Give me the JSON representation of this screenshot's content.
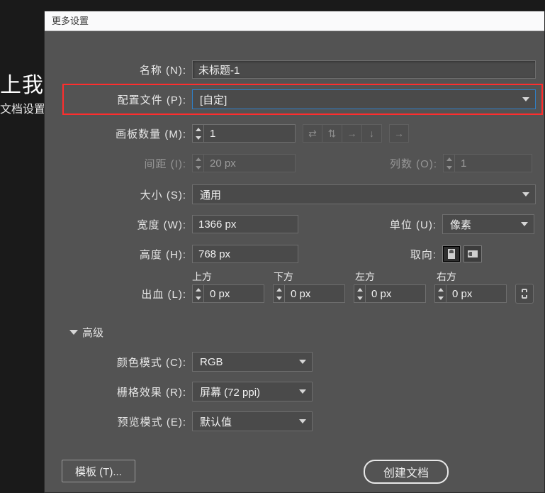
{
  "backdrop": {
    "welcome": "上我",
    "subtext": "文档设置"
  },
  "dialog": {
    "title": "更多设置",
    "name_label": "名称 (N):",
    "name_value": "未标题-1",
    "profile_label": "配置文件 (P):",
    "profile_value": "[自定]",
    "artboard_label": "画板数量 (M):",
    "artboard_value": "1",
    "spacing_label": "间距 (I):",
    "spacing_value": "20 px",
    "cols_label": "列数 (O):",
    "cols_value": "1",
    "size_label": "大小 (S):",
    "size_value": "通用",
    "width_label": "宽度 (W):",
    "width_value": "1366 px",
    "unit_label": "单位 (U):",
    "unit_value": "像素",
    "height_label": "高度 (H):",
    "height_value": "768 px",
    "orient_label": "取向:",
    "bleed_label": "出血 (L):",
    "bleed_top": "上方",
    "bleed_bottom": "下方",
    "bleed_left": "左方",
    "bleed_right": "右方",
    "bleed_val": "0 px",
    "adv_label": "高级",
    "color_label": "颜色模式 (C):",
    "color_value": "RGB",
    "raster_label": "栅格效果 (R):",
    "raster_value": "屏幕 (72 ppi)",
    "preview_label": "预览模式 (E):",
    "preview_value": "默认值",
    "template_btn": "模板 (T)...",
    "create_btn": "创建文档"
  }
}
